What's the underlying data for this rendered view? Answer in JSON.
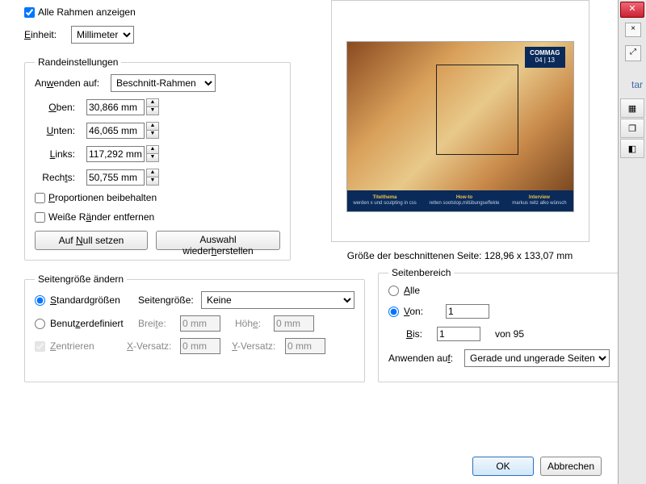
{
  "top": {
    "show_all_frames": "Alle Rahmen anzeigen",
    "unit_label": "Einheit:",
    "unit_value": "Millimeter"
  },
  "margins": {
    "legend": "Randeinstellungen",
    "apply_to_label": "Anwenden auf:",
    "apply_to_value": "Beschnitt-Rahmen",
    "top_label": "Oben:",
    "top_value": "30,866 mm",
    "bottom_label": "Unten:",
    "bottom_value": "46,065 mm",
    "left_label": "Links:",
    "left_value": "117,292 mm",
    "right_label": "Rechts:",
    "right_value": "50,755 mm",
    "keep_proportions": "Proportionen beibehalten",
    "remove_white": "Weiße Ränder entfernen",
    "reset_zero": "Auf Null setzen",
    "restore_sel": "Auswahl wiederherstellen"
  },
  "preview": {
    "tag_line1": "COMMAG",
    "tag_line2": "04 | 13",
    "f1a": "Titelthema",
    "f1b": "werden x und sculpting in css",
    "f2a": "How-to",
    "f2b": "retten sootstop,mitübungseffekte",
    "f3a": "Interview",
    "f3b": "markus reitz alko wünsch",
    "crop_info": "Größe der beschnittenen Seite: 128,96 x 133,07 mm"
  },
  "pagesize": {
    "legend": "Seitengröße ändern",
    "std": "Standardgrößen",
    "custom": "Benutzerdefiniert",
    "label": "Seitengröße:",
    "value": "Keine",
    "width_label": "Breite:",
    "width_value": "0 mm",
    "height_label": "Höhe:",
    "height_value": "0 mm",
    "center": "Zentrieren",
    "xoff_label": "X-Versatz:",
    "xoff_value": "0 mm",
    "yoff_label": "Y-Versatz:",
    "yoff_value": "0 mm"
  },
  "range": {
    "legend": "Seitenbereich",
    "all": "Alle",
    "from_label": "Von:",
    "from_value": "1",
    "to_label": "Bis:",
    "to_value": "1",
    "of": "von 95",
    "apply_label": "Anwenden auf:",
    "apply_value": "Gerade und ungerade Seiten"
  },
  "ok": "OK",
  "cancel": "Abbrechen",
  "side": {
    "tar": "tar"
  }
}
